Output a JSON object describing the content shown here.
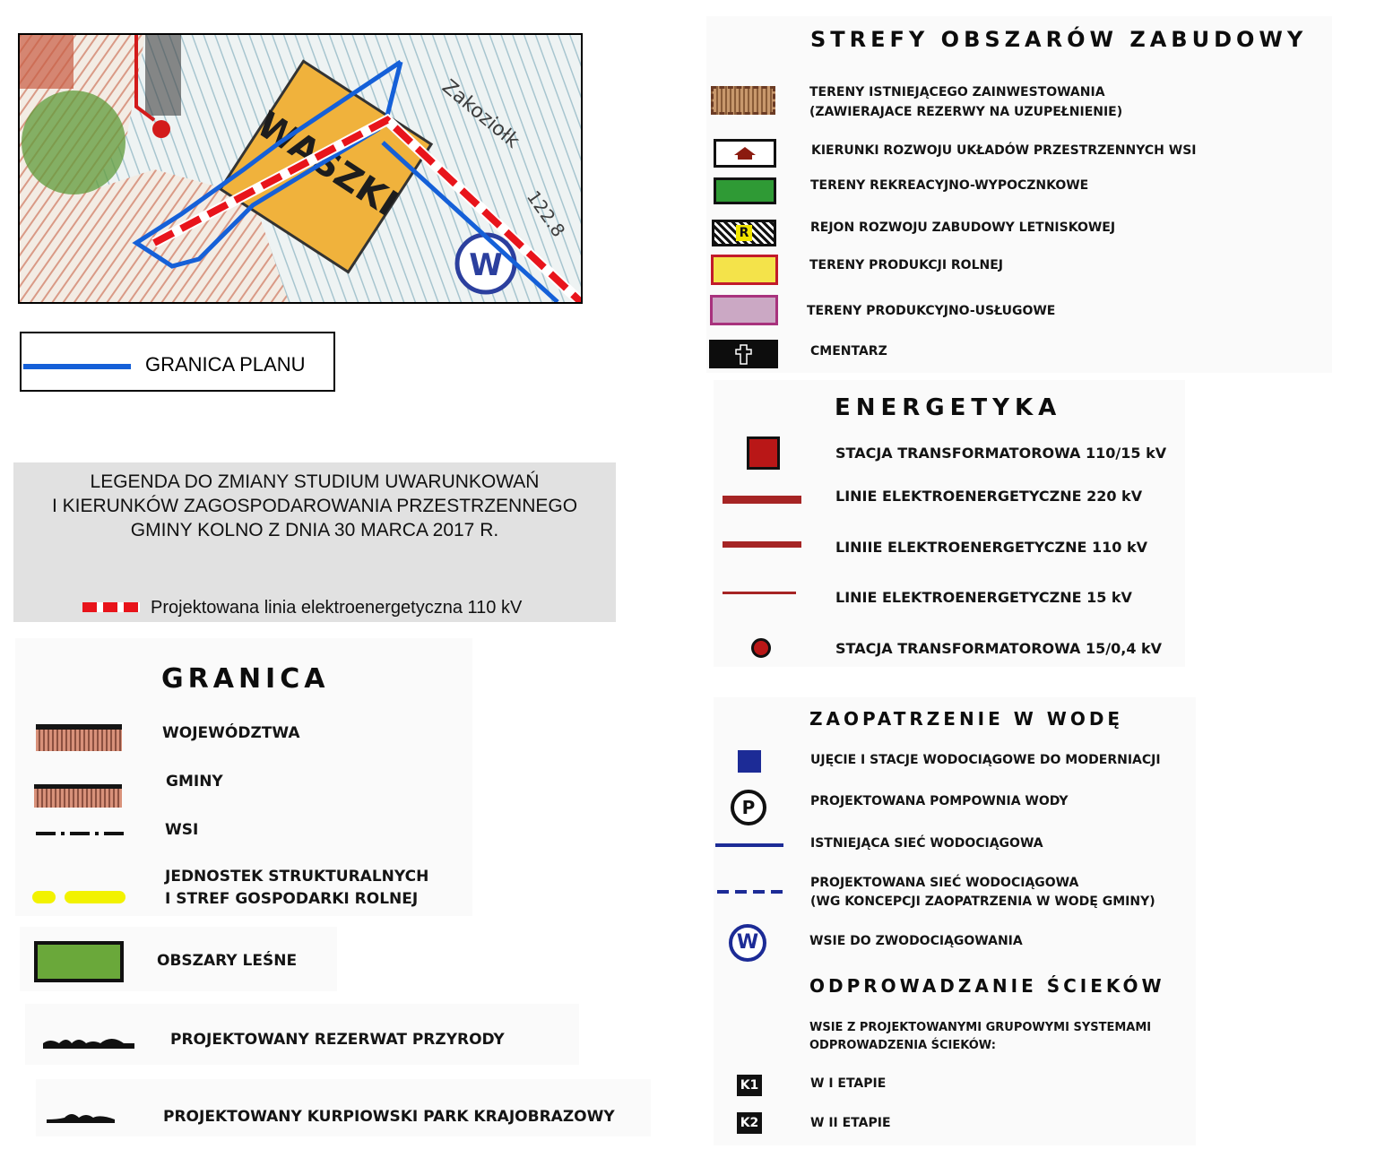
{
  "map_inset": {
    "labels": [
      "WASZKI",
      "Zakoziołk",
      "122.8",
      "W"
    ]
  },
  "plan_boundary": {
    "label": "GRANICA PLANU",
    "color": "#1560d8"
  },
  "legend_title": "LEGENDA  DO ZMIANY STUDIUM UWARUNKOWAŃ\nI KIERUNKÓW ZAGOSPODAROWANIA PRZESTRZENNEGO\nGMINY KOLNO Z DNIA 30 MARCA 2017 R.",
  "projected_line": {
    "label": "Projektowana linia elektroenergetyczna 110 kV",
    "color": "#e8141b"
  },
  "granica": {
    "heading": "GRANICA",
    "items": [
      "WOJEWÓDZTWA",
      "GMINY",
      "WSI",
      "JEDNOSTEK STRUKTURALNYCH\nI STREF GOSPODARKI ROLNEJ",
      "OBSZARY LEŚNE",
      "PROJEKTOWANY REZERWAT PRZYRODY",
      "PROJEKTOWANY KURPIOWSKI PARK KRAJOBRAZOWY"
    ]
  },
  "strefy": {
    "heading": "STREFY OBSZARÓW ZABUDOWY",
    "items": [
      "TERENY ISTNIEJĄCEGO ZAINWESTOWANIA\n(ZAWIERAJACE REZERWY NA UZUPEŁNIENIE)",
      "KIERUNKI ROZWOJU UKŁADÓW PRZESTRZENNYCH WSI",
      "TERENY REKREACYJNO-WYPOCZNKOWE",
      "REJON ROZWOJU ZABUDOWY LETNISKOWEJ",
      "TERENY PRODUKCJI ROLNEJ",
      "TERENY PRODUKCYJNO-USŁUGOWE",
      "CMENTARZ"
    ],
    "letnisko_symbol": "R"
  },
  "energetyka": {
    "heading": "ENERGETYKA",
    "items": [
      "STACJA TRANSFORMATOROWA 110/15 kV",
      "LINIE ELEKTROENERGETYCZNE 220 kV",
      "LINIIE ELEKTROENERGETYCZNE 110 kV",
      "LINIE ELEKTROENERGETYCZNE 15 kV",
      "STACJA TRANSFORMATOROWA 15/0,4 kV"
    ]
  },
  "woda": {
    "heading": "ZAOPATRZENIE W WODĘ",
    "items": [
      "UJĘCIE I STACJE WODOCIĄGOWE DO MODERNIACJI",
      "PROJEKTOWANA POMPOWNIA WODY",
      "ISTNIEJĄCA SIEĆ WODOCIĄGOWA",
      "PROJEKTOWANA SIEĆ WODOCIĄGOWA\n(WG KONCEPCJI ZAOPATRZENIA W WODĘ GMINY)",
      "WSIE DO ZWODOCIĄGOWANIA"
    ],
    "pump_symbol": "P",
    "village_symbol": "W"
  },
  "scieki": {
    "heading": "ODPROWADZANIE ŚCIEKÓW",
    "intro": "WSIE Z PROJEKTOWANYMI GRUPOWYMI SYSTEMAMI\nODPROWADZENIA ŚCIEKÓW:",
    "stages": [
      {
        "symbol": "K1",
        "label": "W I ETAPIE"
      },
      {
        "symbol": "K2",
        "label": "W II ETAPIE"
      }
    ]
  }
}
